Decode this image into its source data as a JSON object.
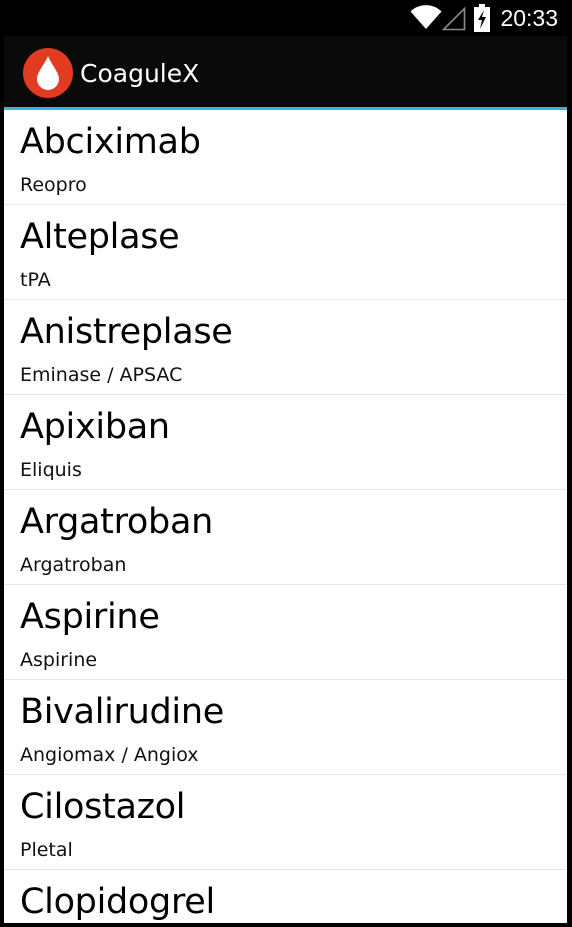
{
  "status_bar": {
    "time": "20:33",
    "icons": [
      "wifi-icon",
      "cell-signal-icon",
      "battery-charging-icon"
    ]
  },
  "app": {
    "title": "CoaguleX",
    "icon": "blood-drop-icon",
    "colors": {
      "action_bar": "#0a0a0a",
      "accent": "#33b5e5",
      "icon_red": "#e13b21"
    }
  },
  "drugs": [
    {
      "name": "Abciximab",
      "brand": "Reopro"
    },
    {
      "name": "Alteplase",
      "brand": "tPA"
    },
    {
      "name": "Anistreplase",
      "brand": "Eminase / APSAC"
    },
    {
      "name": "Apixiban",
      "brand": "Eliquis"
    },
    {
      "name": "Argatroban",
      "brand": "Argatroban"
    },
    {
      "name": "Aspirine",
      "brand": "Aspirine"
    },
    {
      "name": "Bivalirudine",
      "brand": "Angiomax / Angiox"
    },
    {
      "name": "Cilostazol",
      "brand": "Pletal"
    },
    {
      "name": "Clopidogrel",
      "brand": ""
    }
  ]
}
